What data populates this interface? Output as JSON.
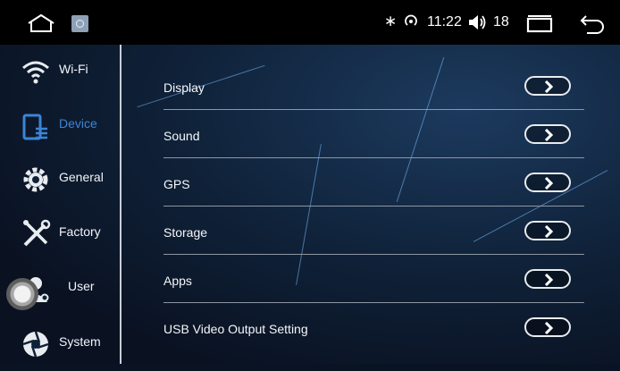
{
  "status_bar": {
    "clock": "11:22",
    "volume_level": "18",
    "icons": [
      "home-icon",
      "app-icon",
      "bluetooth-icon",
      "wifi-hotspot-icon",
      "volume-icon",
      "recent-apps-icon",
      "back-icon"
    ],
    "bluetooth_glyph": "∗"
  },
  "sidebar": {
    "items": [
      {
        "label": "Wi-Fi",
        "icon": "wifi-icon",
        "active": false
      },
      {
        "label": "Device",
        "icon": "device-icon",
        "active": true
      },
      {
        "label": "General",
        "icon": "gear-icon",
        "active": false
      },
      {
        "label": "Factory",
        "icon": "tools-icon",
        "active": false
      },
      {
        "label": "User",
        "icon": "user-icon",
        "active": false
      },
      {
        "label": "System",
        "icon": "aperture-icon",
        "active": false
      }
    ]
  },
  "menu": {
    "items": [
      {
        "label": "Display"
      },
      {
        "label": "Sound"
      },
      {
        "label": "GPS"
      },
      {
        "label": "Storage"
      },
      {
        "label": "Apps"
      },
      {
        "label": "USB Video Output Setting"
      }
    ]
  },
  "colors": {
    "active_accent": "#3d84d6",
    "background": "#0a1324",
    "status_bar": "#000000"
  }
}
